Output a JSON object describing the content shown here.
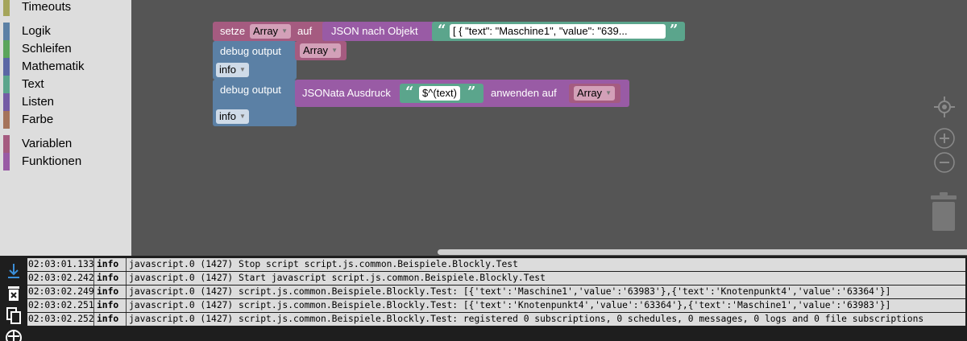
{
  "toolbox": {
    "items": [
      {
        "label": "Timeouts",
        "color": "#a5a55b"
      },
      {
        "label": "Logik",
        "color": "#5b80a5"
      },
      {
        "label": "Schleifen",
        "color": "#5ba55b"
      },
      {
        "label": "Mathematik",
        "color": "#5b67a5"
      },
      {
        "label": "Text",
        "color": "#5ba58c"
      },
      {
        "label": "Listen",
        "color": "#745ba5"
      },
      {
        "label": "Farbe",
        "color": "#a5745b"
      },
      {
        "label": "Variablen",
        "color": "#a55b80"
      },
      {
        "label": "Funktionen",
        "color": "#995ba5"
      }
    ]
  },
  "blocks": {
    "set_var": {
      "prefix": "setze",
      "variable": "Array",
      "suffix": "auf",
      "color": "#a55b80"
    },
    "json_parse": {
      "label": "JSON nach Objekt",
      "string_value": "[  {      \"text\": \"Maschine1\",      \"value\": \"639...",
      "color": "#995ba5"
    },
    "debug1": {
      "label": "debug output",
      "variable": "Array",
      "level": "info",
      "color": "#5b80a5"
    },
    "debug2": {
      "label": "debug output",
      "level": "info",
      "color": "#5b80a5"
    },
    "jsonata": {
      "label": "JSONata Ausdruck",
      "expression": "$^(text)",
      "apply_label": "anwenden auf",
      "variable": "Array",
      "color": "#995ba5"
    },
    "text_color": "#5ba58c"
  },
  "log": {
    "rows": [
      {
        "time": "02:03:01.133",
        "level": "info",
        "message": "javascript.0 (1427) Stop script script.js.common.Beispiele.Blockly.Test"
      },
      {
        "time": "02:03:02.242",
        "level": "info",
        "message": "javascript.0 (1427) Start javascript script.js.common.Beispiele.Blockly.Test"
      },
      {
        "time": "02:03:02.249",
        "level": "info",
        "message": "javascript.0 (1427) script.js.common.Beispiele.Blockly.Test: [{'text':'Maschine1','value':'63983'},{'text':'Knotenpunkt4','value':'63364'}]"
      },
      {
        "time": "02:03:02.251",
        "level": "info",
        "message": "javascript.0 (1427) script.js.common.Beispiele.Blockly.Test: [{'text':'Knotenpunkt4','value':'63364'},{'text':'Maschine1','value':'63983'}]"
      },
      {
        "time": "02:03:02.252",
        "level": "info",
        "message": "javascript.0 (1427) script.js.common.Beispiele.Blockly.Test: registered 0 subscriptions, 0 schedules, 0 messages, 0 logs and 0 file subscriptions"
      }
    ]
  },
  "icons": {
    "tools": [
      "download-icon",
      "clear-log-icon",
      "copy-icon",
      "table-icon"
    ],
    "workspace": [
      "center-target-icon",
      "zoom-in-icon",
      "zoom-out-icon",
      "trash-icon"
    ]
  }
}
